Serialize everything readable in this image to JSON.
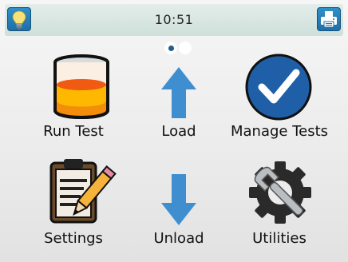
{
  "status_bar": {
    "time": "10:51",
    "left_icon": "lightbulb-icon",
    "right_icon": "printer-icon"
  },
  "pager": {
    "pages": 2,
    "current": 1
  },
  "tiles": [
    {
      "label": "Run Test",
      "icon": "beaker-icon"
    },
    {
      "label": "Load",
      "icon": "arrow-up-icon"
    },
    {
      "label": "Manage Tests",
      "icon": "checkmark-icon"
    },
    {
      "label": "Settings",
      "icon": "clipboard-pencil-icon"
    },
    {
      "label": "Unload",
      "icon": "arrow-down-icon"
    },
    {
      "label": "Utilities",
      "icon": "gear-wrench-icon"
    }
  ],
  "colors": {
    "accent_blue": "#1f6fa6",
    "arrow_blue": "#3f8fd0",
    "status_bar": "#d6e6e0"
  }
}
